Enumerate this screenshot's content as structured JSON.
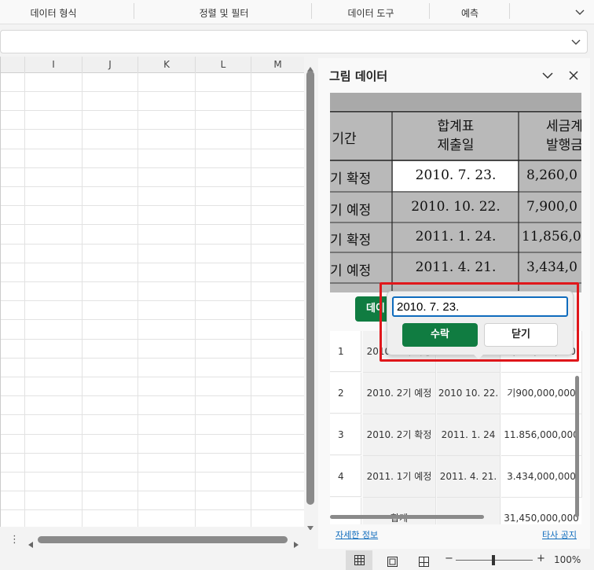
{
  "ribbon": {
    "groups": [
      "데이터 형식",
      "정렬 및 필터",
      "데이터 도구",
      "예측"
    ]
  },
  "columns": [
    "I",
    "J",
    "K",
    "L",
    "M"
  ],
  "panel": {
    "title": "그림 데이터",
    "image_table": {
      "header": [
        "기간",
        "합계표\n제출일",
        "세금계\n발행금"
      ],
      "rows": [
        [
          "기 확정",
          "2010. 7. 23.",
          "8,260,0"
        ],
        [
          "기 예정",
          "2010. 10. 22.",
          "7,900,0"
        ],
        [
          "기 확정",
          "2011. 1. 24.",
          "11,856,0"
        ],
        [
          "기 예정",
          "2011. 4. 21.",
          "3,434,0"
        ]
      ]
    },
    "insert_button_label": "데이",
    "data_rows": [
      {
        "num": "1",
        "period": "2010. 1기 확정",
        "date": "2010. 7. 23.",
        "amount": "8,260,000,000"
      },
      {
        "num": "2",
        "period": "2010. 2기 예정",
        "date": "2010 10. 22.",
        "amount": "기900,000,000"
      },
      {
        "num": "3",
        "period": "2010. 2기 확정",
        "date": "2011. 1. 24",
        "amount": "11.856,000,000"
      },
      {
        "num": "4",
        "period": "2011. 1기 예정",
        "date": "2011. 4. 21.",
        "amount": "3.434,000,000"
      },
      {
        "num": "",
        "period": "합계",
        "date": "",
        "amount": "31,450,000,000"
      }
    ],
    "link_details": "자세한 정보",
    "link_privacy": "타사 공지"
  },
  "popup": {
    "input_value": "2010. 7. 23.",
    "accept_label": "수락",
    "close_label": "닫기"
  },
  "status": {
    "zoom": "100%",
    "zoom_minus": "−",
    "zoom_plus": "+"
  },
  "colors": {
    "accent": "#107c41",
    "highlight": "#e0171b"
  }
}
